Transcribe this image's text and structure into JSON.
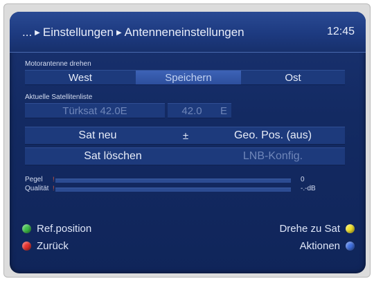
{
  "header": {
    "prefix": "...",
    "crumb_1": "Einstellungen",
    "crumb_2": "Antenneneinstellungen",
    "time": "12:45"
  },
  "motor": {
    "label": "Motorantenne drehen",
    "west": "West",
    "save": "Speichern",
    "east": "Ost"
  },
  "satlist": {
    "label": "Aktuelle Satellitenliste",
    "name": "Türksat 42.0E",
    "position": "42.0",
    "direction": "E"
  },
  "actions": {
    "sat_new": "Sat neu",
    "plusminus": "±",
    "geo_pos": "Geo. Pos. (aus)",
    "sat_delete": "Sat löschen",
    "lnb": "LNB-Konfig."
  },
  "signal": {
    "level_label": "Pegel",
    "level_value": "0",
    "quality_label": "Qualität",
    "quality_value": "-.-dB"
  },
  "footer": {
    "green_label": "Ref.position",
    "red_label": "Zurück",
    "yellow_label": "Drehe zu Sat",
    "blue_label": "Aktionen"
  },
  "colors": {
    "green": "#3fc04a",
    "red": "#e8322e",
    "yellow": "#f2e12c",
    "blue": "#3f6fe0"
  }
}
